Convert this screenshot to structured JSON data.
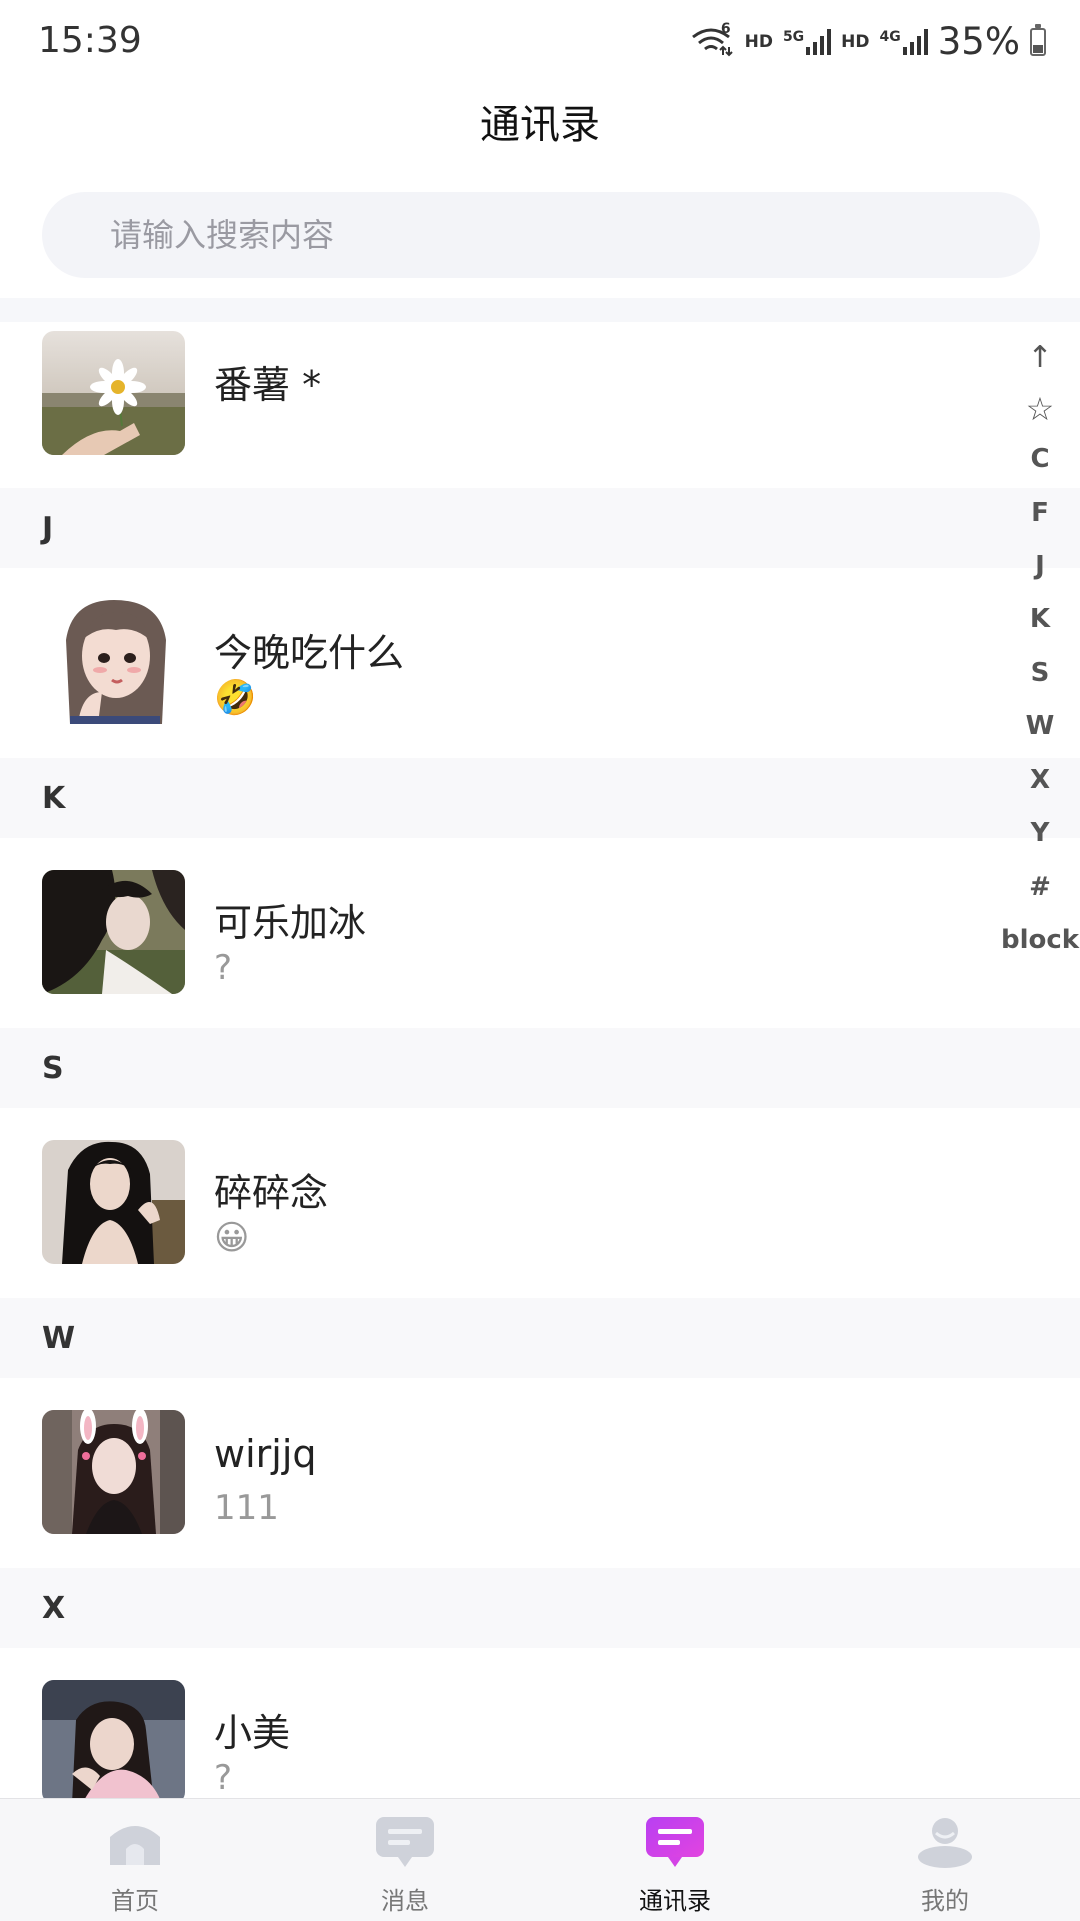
{
  "status_bar": {
    "time": "15:39",
    "wifi_badge": "6",
    "hd1": "HD",
    "net5g": "5G",
    "hd2": "HD",
    "net4g": "4G",
    "battery": "35%",
    "battery_level": 0.35
  },
  "header": {
    "title": "通讯录"
  },
  "search": {
    "placeholder": "请输入搜索内容",
    "value": ""
  },
  "contacts_top": {
    "name": "番薯 *"
  },
  "sections": [
    {
      "letter": "J",
      "contact": {
        "name": "今晚吃什么",
        "status": "🤣"
      }
    },
    {
      "letter": "K",
      "contact": {
        "name": "可乐加冰",
        "status": "?"
      }
    },
    {
      "letter": "S",
      "contact": {
        "name": "碎碎念",
        "status": "😀"
      }
    },
    {
      "letter": "W",
      "contact": {
        "name": "wirjjq",
        "status": "111"
      }
    },
    {
      "letter": "X",
      "contact": {
        "name": "小美",
        "status": "?"
      }
    }
  ],
  "index_rail": [
    "↑",
    "☆",
    "C",
    "F",
    "J",
    "K",
    "S",
    "W",
    "X",
    "Y",
    "#",
    "block"
  ],
  "tabs": [
    {
      "label": "首页",
      "icon": "home-icon"
    },
    {
      "label": "消息",
      "icon": "message-icon"
    },
    {
      "label": "通讯录",
      "icon": "contacts-icon",
      "active": true
    },
    {
      "label": "我的",
      "icon": "profile-icon"
    }
  ],
  "colors": {
    "accent": "#c640f0",
    "inactive_icon": "#cfd2da",
    "section_bg": "#f8f8fa"
  }
}
